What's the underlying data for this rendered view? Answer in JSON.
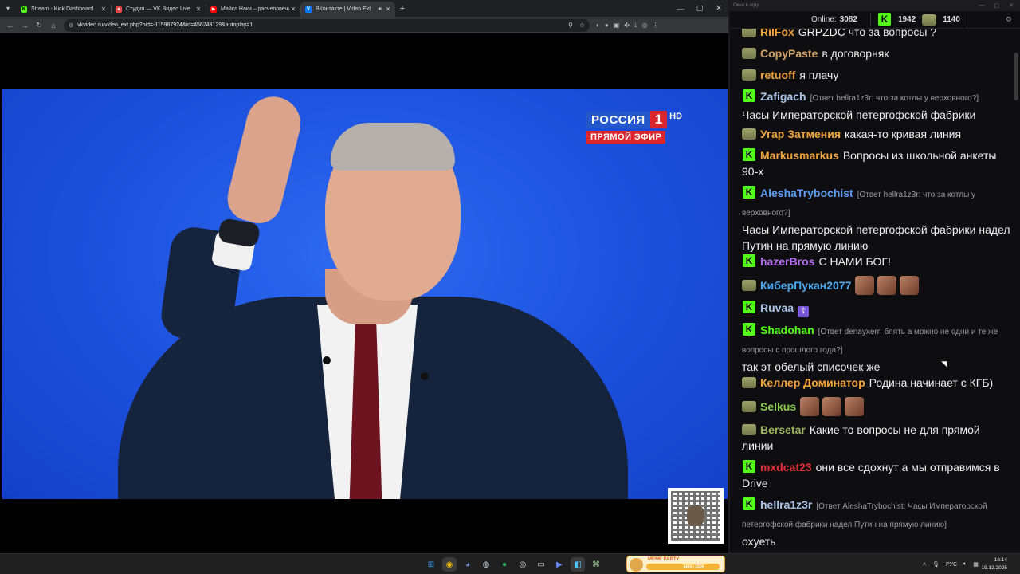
{
  "browser": {
    "tabs": [
      {
        "label": "Stream - Kick Dashboard",
        "icon": "kick-icon",
        "color": "#53fc18",
        "active": false
      },
      {
        "label": "Студия — VK Видео Live",
        "icon": "vk-live-icon",
        "color": "#e64646",
        "active": false
      },
      {
        "label": "Майкл Наки – расчеловечиван",
        "icon": "youtube-icon",
        "color": "#ff0000",
        "active": false
      },
      {
        "label": "ВКонтакте | Video Ext",
        "icon": "vk-icon",
        "color": "#0077ff",
        "active": true
      }
    ],
    "address": "vkvideo.ru/video_ext.php?oid=-115987924&id=456243129&autoplay=1"
  },
  "video": {
    "channel_name": "РОССИЯ",
    "channel_number": "1",
    "channel_hd": "HD",
    "live_label": "ПРЯМОЙ ЭФИР"
  },
  "chat": {
    "window_title": "Окно в игру",
    "online_label": "Online:",
    "online_value": "3082",
    "kick_count": "1942",
    "vk_count": "1140",
    "messages": [
      {
        "badge": "pepe",
        "user": "RilFox",
        "color": "#f2a33a",
        "text": "GRPZDC что за вопросы ?",
        "user2_color": "#f2a33a"
      },
      {
        "badge": "pepe",
        "user": "CopyPaste",
        "color": "#d4a265",
        "text": "в договорняк"
      },
      {
        "badge": "pepe",
        "user": "retuoff",
        "color": "#f2a33a",
        "text": "я плачу"
      },
      {
        "badge": "k",
        "user": "Zafigach",
        "color": "#a9c4e8",
        "reply": "[Ответ hellra1z3r: что за котлы у верховного?]",
        "text": "Часы Императорской петергофской фабрики"
      },
      {
        "badge": "pepe",
        "user": "Угар Затмения",
        "color": "#f2a33a",
        "text": "какая-то кривая линия"
      },
      {
        "badge": "k",
        "user": "Markusmarkus",
        "color": "#f2a33a",
        "text": "Вопросы из школьной анкеты 90-х"
      },
      {
        "badge": "k",
        "user": "AleshaTrybochist",
        "color": "#5b9bf0",
        "reply": "[Ответ hellra1z3r: что за котлы у верховного?]",
        "text": "Часы Императорской петергофской фабрики надел Путин на прямую линию"
      },
      {
        "badge": "k",
        "user": "hazerBros",
        "color": "#b56cf0",
        "text": "С НАМИ БОГ!"
      },
      {
        "badge": "pepe",
        "user": "КиберПукан2077",
        "color": "#4aa8f0",
        "text": ""
      },
      {
        "badge": "k",
        "user": "Ruvaa",
        "color": "#a9c4e8",
        "text": ""
      },
      {
        "badge": "k",
        "user": "Shadohan",
        "color": "#53fc18",
        "reply": "[Ответ denayxerr: блять а можно не одни и те же вопросы с прошлого года?]",
        "text": "так эт обелый списочек же"
      },
      {
        "badge": "pepe",
        "user": "Келлер Доминатор",
        "color": "#f2a33a",
        "text": "Родина начинает с КГБ)"
      },
      {
        "badge": "pepe",
        "user": "Selkus",
        "color": "#88c84a",
        "text": ""
      },
      {
        "badge": "pepe",
        "user": "Bersetar",
        "color": "#a0b060",
        "text": "Какие то вопросы не для прямой линии"
      },
      {
        "badge": "k",
        "user": "mxdcat23",
        "color": "#e8303a",
        "text": "они все сдохнут а мы отправимся в Drive"
      },
      {
        "badge": "k",
        "user": "hellra1z3r",
        "color": "#a9c4e8",
        "reply": "[Ответ AleshaTrybochist: Часы Императорской петергофской фабрики надел Путин на прямую линию]",
        "text": "охуеть"
      }
    ]
  },
  "taskbar": {
    "meme_label": "MEME PARTY",
    "meme_count": "1400 / 1500",
    "lang": "РУС",
    "time": "16:14",
    "date": "19.12.2025"
  }
}
